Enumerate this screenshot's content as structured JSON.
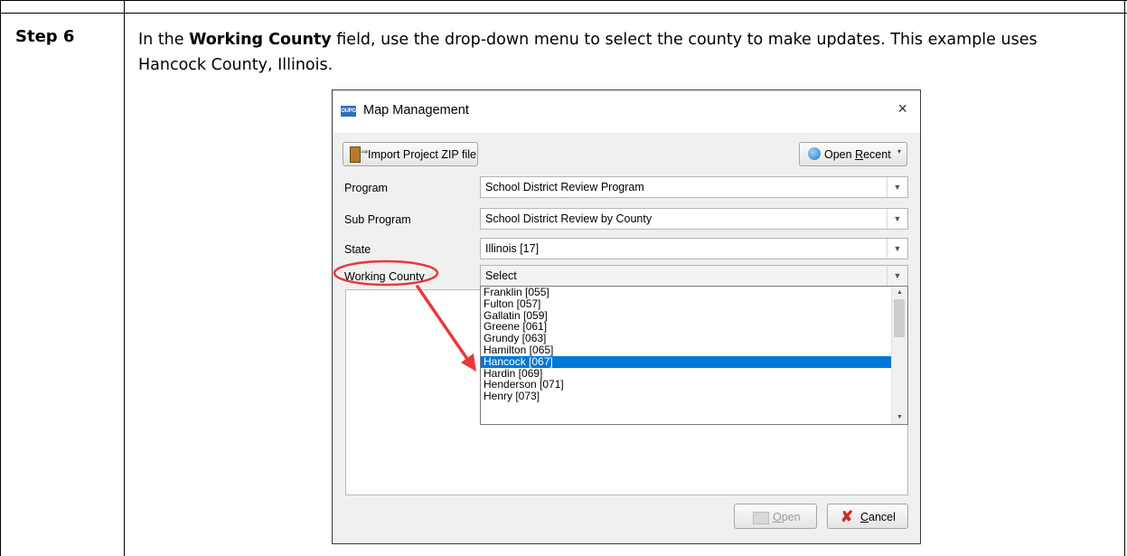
{
  "step": {
    "label": "Step 6",
    "text_before": "In the ",
    "text_bold": "Working County",
    "text_after": " field, use the drop-down menu to select the county to make updates. This example uses Hancock County, Illinois."
  },
  "dialog": {
    "icon_text": "OUPG",
    "title": "Map Management",
    "close_glyph": "×",
    "import_button": {
      "label": "Import Project ZIP file",
      "icon": "import-zip-icon"
    },
    "open_recent_button": {
      "label_pre": "Open ",
      "label_ul": "R",
      "label_post": "ecent",
      "icon": "globe-icon",
      "caret": "▾"
    },
    "fields": [
      {
        "label": "Program",
        "value": "School District Review Program"
      },
      {
        "label": "Sub Program",
        "value": "School District Review by County"
      },
      {
        "label": "State",
        "value": "Illinois [17]"
      },
      {
        "label": "Working County",
        "value": "Select"
      }
    ],
    "dropdown_arrow": "▼",
    "dropdown_items": [
      "Franklin [055]",
      "Fulton [057]",
      "Gallatin [059]",
      "Greene [061]",
      "Grundy [063]",
      "Hamilton [065]",
      "Hancock [067]",
      "Hardin [069]",
      "Henderson [071]",
      "Henry [073]"
    ],
    "selected_index": 6,
    "scroll_up": "▲",
    "scroll_down": "▼",
    "open_button": {
      "label_ul": "O",
      "label_post": "pen",
      "enabled": false
    },
    "cancel_button": {
      "label_ul": "C",
      "label_post": "ancel",
      "icon": "cancel-x-icon",
      "glyph": "✘"
    }
  },
  "annotation": {
    "color": "#e8383d"
  }
}
